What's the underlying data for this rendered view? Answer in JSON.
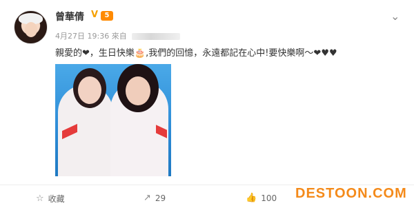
{
  "user": {
    "name": "曾華倩",
    "verified_mark": "V",
    "level_badge": "5"
  },
  "post": {
    "date": "4月27日 19:36",
    "source_prefix": "來自",
    "text": "親愛的❤，生日快樂🎂,我們的回憶，永遠都記在心中!要快樂啊～❤♥♥"
  },
  "actions": {
    "favorite_label": "收藏",
    "share_count": "29",
    "comment_count": "",
    "like_count": "100"
  },
  "icons": {
    "favorite": "star-icon",
    "share": "share-icon",
    "like": "thumbs-up-icon",
    "menu": "chevron-down-icon"
  },
  "watermark": "DESTOON.COM",
  "colors": {
    "accent_orange": "#f48a1a",
    "verified_gold": "#f5a000"
  }
}
